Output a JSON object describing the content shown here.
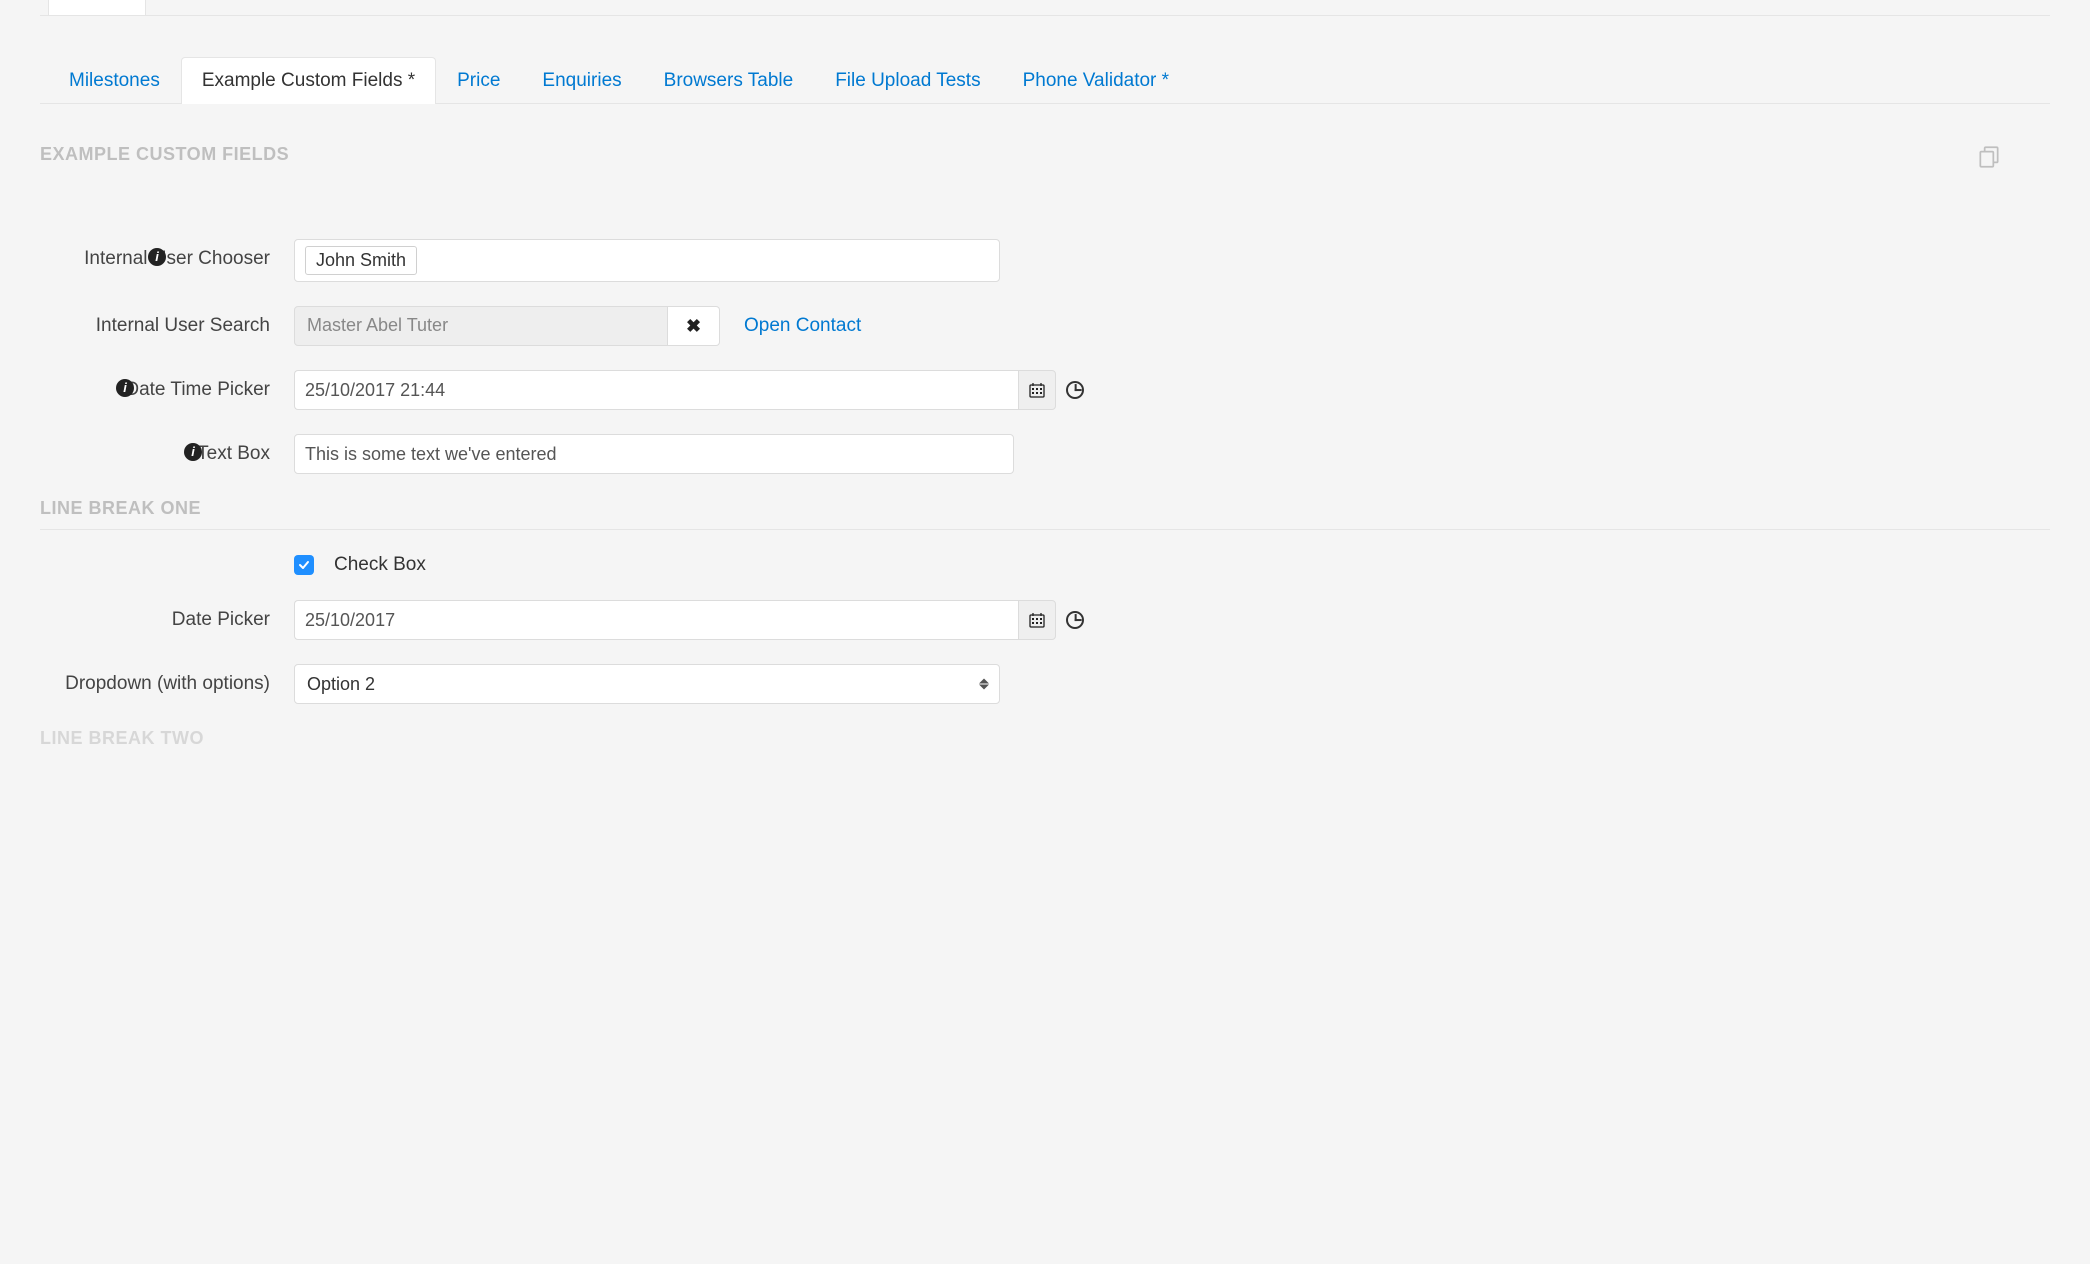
{
  "tabs": [
    {
      "label": "Milestones",
      "active": false
    },
    {
      "label": "Example Custom Fields *",
      "active": true
    },
    {
      "label": "Price",
      "active": false
    },
    {
      "label": "Enquiries",
      "active": false
    },
    {
      "label": "Browsers Table",
      "active": false
    },
    {
      "label": "File Upload Tests",
      "active": false
    },
    {
      "label": "Phone Validator *",
      "active": false
    }
  ],
  "section_title": "EXAMPLE CUSTOM FIELDS",
  "fields": {
    "internal_user_chooser": {
      "label": "Internal User Chooser",
      "token": "John Smith"
    },
    "internal_user_search": {
      "label": "Internal User Search",
      "value": "Master Abel Tuter",
      "link": "Open Contact"
    },
    "date_time_picker": {
      "label": "Date Time Picker",
      "value": "25/10/2017 21:44"
    },
    "text_box": {
      "label": "Text Box",
      "value": "This is some text we've entered"
    }
  },
  "line_break_one": "LINE BREAK ONE",
  "fields2": {
    "check_box": {
      "label": "Check Box",
      "checked": true
    },
    "date_picker": {
      "label": "Date Picker",
      "value": "25/10/2017"
    },
    "dropdown": {
      "label": "Dropdown (with options)",
      "value": "Option 2"
    }
  },
  "line_break_two": "LINE BREAK TWO"
}
